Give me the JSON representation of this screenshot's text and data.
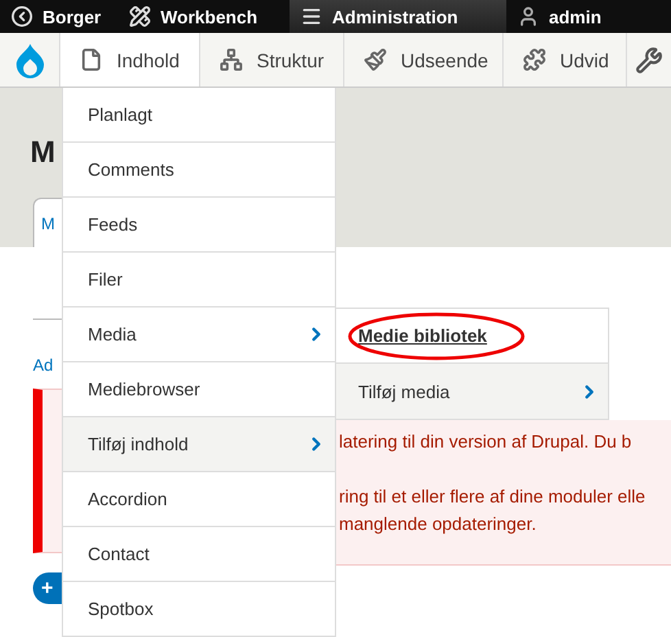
{
  "toolbar": {
    "items": [
      {
        "label": "Borger",
        "selected": false
      },
      {
        "label": "Workbench",
        "selected": false
      },
      {
        "label": "Administration",
        "selected": true
      },
      {
        "label": "admin",
        "selected": false
      }
    ]
  },
  "admin_menu": {
    "items": [
      {
        "label": "Indhold",
        "selected": true
      },
      {
        "label": "Struktur",
        "selected": false
      },
      {
        "label": "Udseende",
        "selected": false
      },
      {
        "label": "Udvid",
        "selected": false
      }
    ]
  },
  "dropdown": {
    "items": [
      {
        "label": "Planlagt",
        "has_submenu": false,
        "highlighted": false
      },
      {
        "label": "Comments",
        "has_submenu": false,
        "highlighted": false
      },
      {
        "label": "Feeds",
        "has_submenu": false,
        "highlighted": false
      },
      {
        "label": "Filer",
        "has_submenu": false,
        "highlighted": false
      },
      {
        "label": "Media",
        "has_submenu": true,
        "highlighted": false
      },
      {
        "label": "Mediebrowser",
        "has_submenu": false,
        "highlighted": false
      },
      {
        "label": "Tilføj indhold",
        "has_submenu": true,
        "highlighted": true
      },
      {
        "label": "Accordion",
        "has_submenu": false,
        "highlighted": false
      },
      {
        "label": "Contact",
        "has_submenu": false,
        "highlighted": false
      },
      {
        "label": "Spotbox",
        "has_submenu": false,
        "highlighted": false
      }
    ]
  },
  "submenu": {
    "items": [
      {
        "label": "Medie bibliotek",
        "current": true,
        "circled": true,
        "has_submenu": false,
        "highlighted": false
      },
      {
        "label": "Tilføj media",
        "current": false,
        "circled": false,
        "has_submenu": true,
        "highlighted": true
      }
    ]
  },
  "page": {
    "title": "M",
    "tab": "M",
    "link": "Ad",
    "button": "+",
    "message_lines": [
      "latering til din version af Drupal. Du b",
      "ring til et eller flere af dine moduler elle",
      "manglende opdateringer."
    ]
  }
}
